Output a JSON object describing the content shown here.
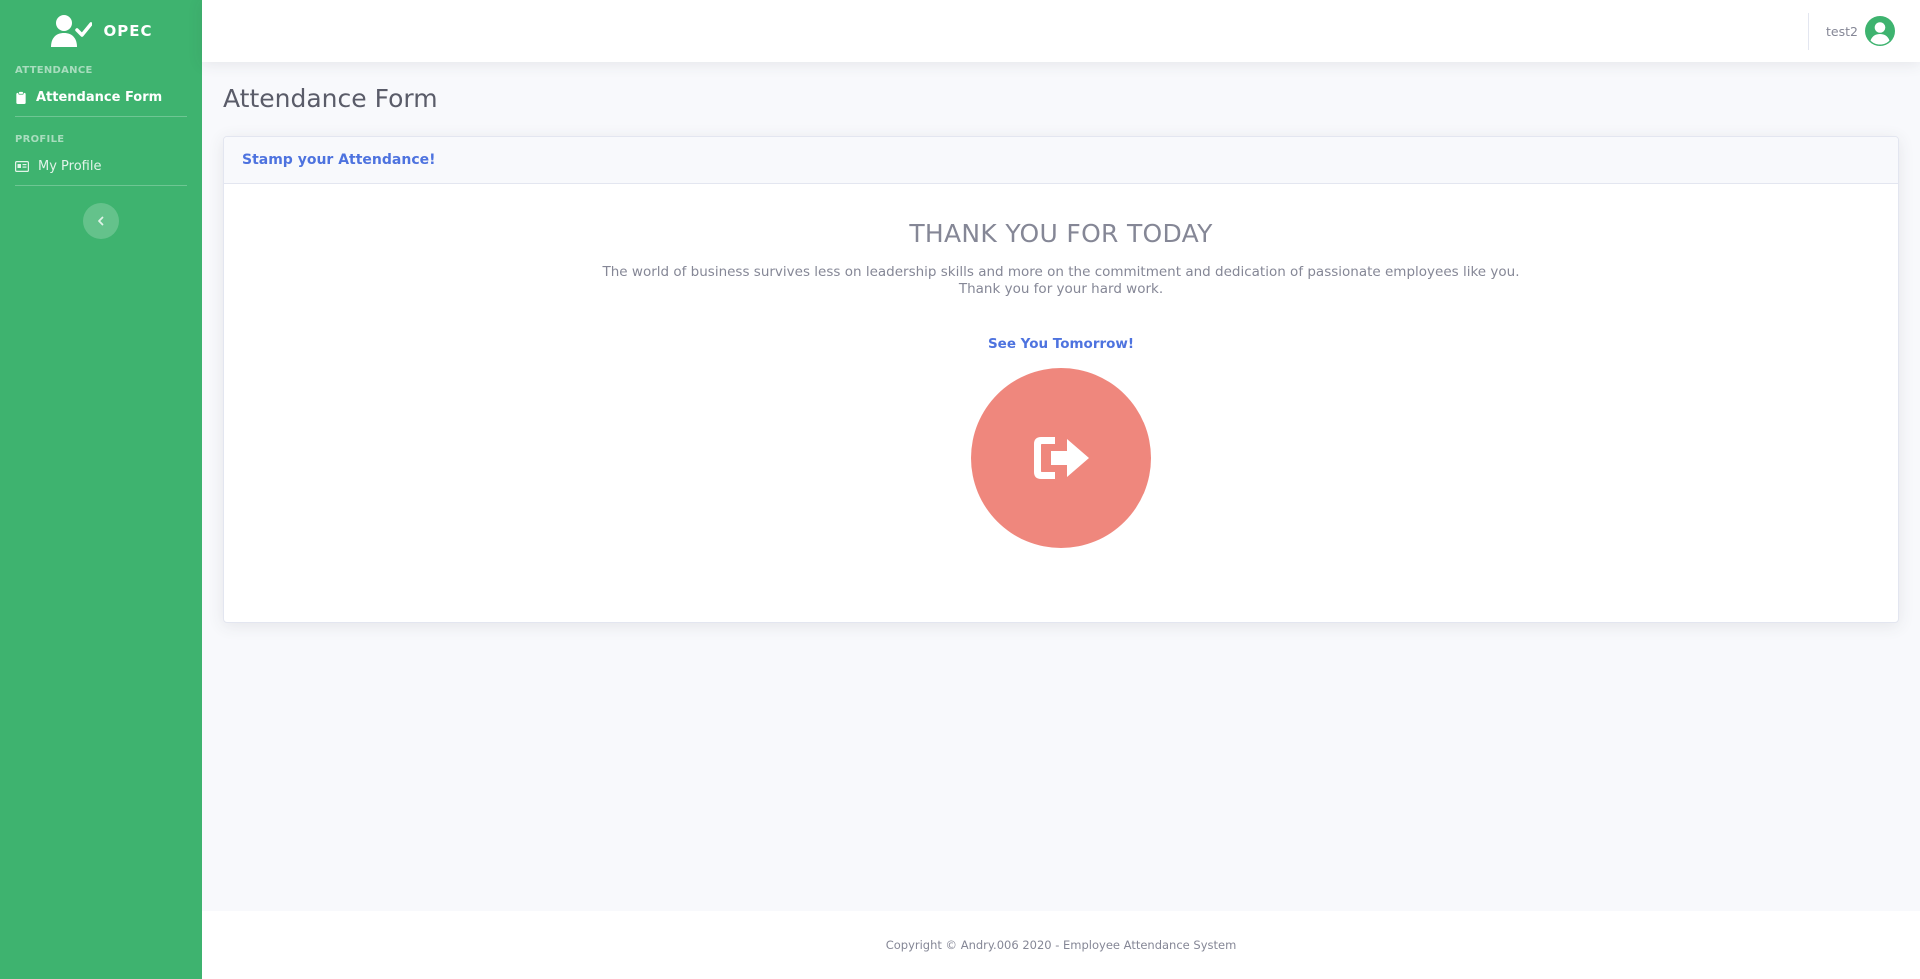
{
  "sidebar": {
    "brand": {
      "name": "OPEC",
      "icon": "user-check-icon"
    },
    "sections": [
      {
        "heading": "Attendance",
        "items": [
          {
            "label": "Attendance Form",
            "icon": "clipboard-icon",
            "active": true
          }
        ]
      },
      {
        "heading": "Profile",
        "items": [
          {
            "label": "My Profile",
            "icon": "id-card-icon",
            "active": false
          }
        ]
      }
    ],
    "toggle_icon": "chevron-left-icon"
  },
  "topbar": {
    "user_name": "test2",
    "avatar_icon": "user-circle-icon"
  },
  "main": {
    "page_title": "Attendance Form",
    "card": {
      "header_title": "Stamp your Attendance!",
      "heading": "THANK YOU FOR TODAY",
      "message_line1": "The world of business survives less on leadership skills and more on the commitment and dedication of passionate employees like you.",
      "message_line2": "Thank you for your hard work.",
      "sub_heading": "See You Tomorrow!",
      "action_icon": "sign-out-icon"
    }
  },
  "footer": {
    "copyright": "Copyright © Andry.006 2020 - Employee Attendance System"
  },
  "colors": {
    "sidebar_bg": "#3eb36f",
    "primary": "#4e73df",
    "logout_button": "#ef877d",
    "text_muted": "#858796",
    "page_bg": "#f8f9fc"
  }
}
